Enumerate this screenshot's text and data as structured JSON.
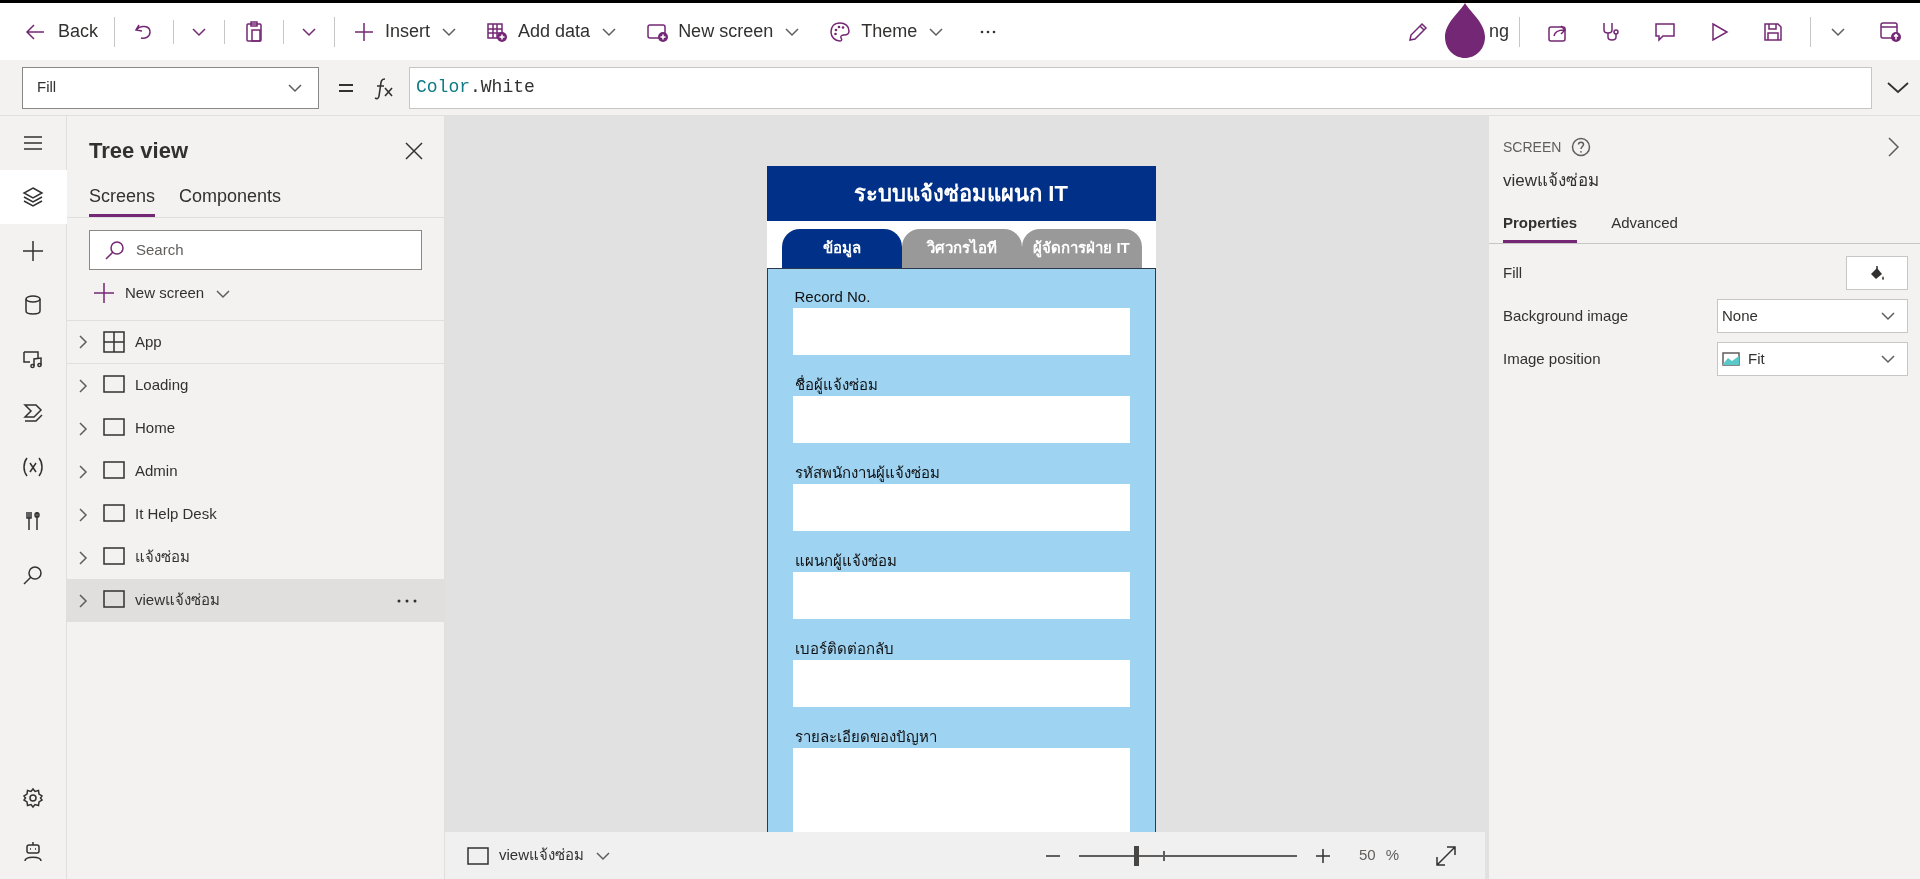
{
  "toolbar": {
    "back": "Back",
    "menus": [
      {
        "kind": "insert",
        "label": "Insert"
      },
      {
        "kind": "data",
        "label": "Add data"
      },
      {
        "kind": "screen",
        "label": "New screen"
      },
      {
        "kind": "theme",
        "label": "Theme"
      }
    ],
    "editing_fragment": "ng"
  },
  "formula_bar": {
    "property": "Fill",
    "formula": [
      {
        "text": "Color",
        "kind": "identifier"
      },
      {
        "text": ".White",
        "kind": "member"
      }
    ]
  },
  "tree_view": {
    "title": "Tree view",
    "tabs": [
      {
        "label": "Screens",
        "selected": true
      },
      {
        "label": "Components",
        "selected": false
      }
    ],
    "search": {
      "placeholder": "Search"
    },
    "new_screen": "New screen",
    "items": [
      {
        "kind": "app",
        "label": "App",
        "selected": false
      },
      {
        "kind": "screen",
        "label": "Loading",
        "selected": false
      },
      {
        "kind": "screen",
        "label": "Home",
        "selected": false
      },
      {
        "kind": "screen",
        "label": "Admin",
        "selected": false
      },
      {
        "kind": "screen",
        "label": "It Help Desk",
        "selected": false
      },
      {
        "kind": "screen",
        "label": "แจ้งซ่อม",
        "selected": false
      },
      {
        "kind": "screen",
        "label": "viewแจ้งซ่อม",
        "selected": true
      }
    ]
  },
  "app_screen": {
    "header": "ระบบแจ้งซ่อมแผนก IT",
    "tabs": [
      {
        "label": "ข้อมูล",
        "selected": true
      },
      {
        "label": "วิศวกรไอที",
        "selected": false
      },
      {
        "label": "ผู้จัดการฝ่าย IT",
        "selected": false
      }
    ],
    "fields": [
      {
        "label": "Record No.",
        "kind": "single"
      },
      {
        "label": "ชื่อผู้แจ้งซ่อม",
        "kind": "single"
      },
      {
        "label": "รหัสพนักงานผู้แจ้งซ่อม",
        "kind": "single"
      },
      {
        "label": "แผนกผู้แจ้งซ่อม",
        "kind": "single"
      },
      {
        "label": "เบอร์ติดต่อกลับ",
        "kind": "single"
      },
      {
        "label": "รายละเอียดของปัญหา",
        "kind": "multiline"
      }
    ]
  },
  "bottom_bar": {
    "screen": "viewแจ้งซ่อม",
    "zoom": {
      "level": 0.26
    },
    "zoom_value": "50",
    "zoom_unit": "%"
  },
  "properties_panel": {
    "type": "SCREEN",
    "name": "viewแจ้งซ่อม",
    "tabs": [
      {
        "label": "Properties",
        "selected": true
      },
      {
        "label": "Advanced",
        "selected": false
      }
    ],
    "rows": [
      {
        "label": "Fill",
        "kind": "color"
      },
      {
        "label": "Background image",
        "kind": "dropdown",
        "value": "None"
      },
      {
        "label": "Image position",
        "kind": "image-dropdown",
        "value": "Fit"
      }
    ]
  }
}
